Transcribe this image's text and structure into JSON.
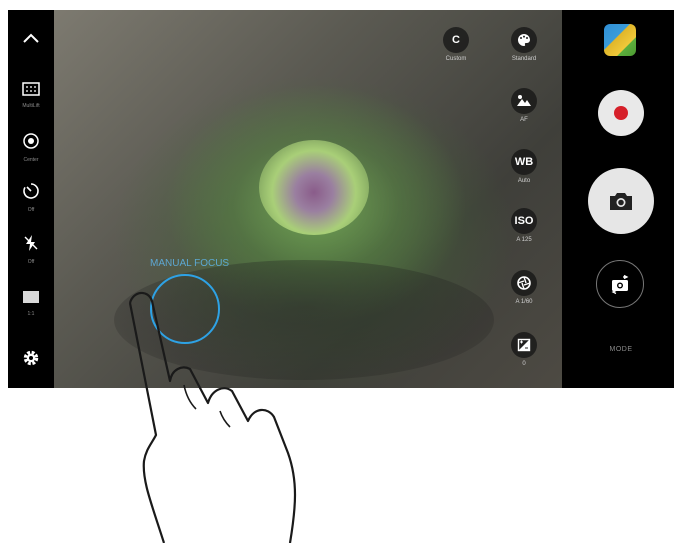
{
  "left_bar": {
    "collapse_icon": "chevron-up-icon",
    "items": [
      {
        "name": "picture-size",
        "icon": "grid-ratio-icon",
        "label": "MultiLift"
      },
      {
        "name": "metering",
        "icon": "metering-icon",
        "label": "Center"
      },
      {
        "name": "timer",
        "icon": "timer-icon",
        "label": "Off"
      },
      {
        "name": "flash",
        "icon": "flash-off-icon",
        "label": "Off"
      },
      {
        "name": "ratio",
        "icon": "aspect-ratio-icon",
        "label": "1:1"
      },
      {
        "name": "settings",
        "icon": "gear-icon",
        "label": ""
      }
    ]
  },
  "viewfinder": {
    "focus_label": "MANUAL FOCUS"
  },
  "controls": [
    {
      "name": "custom",
      "symbol": "C",
      "label": "Custom"
    },
    {
      "name": "tone",
      "symbol": "",
      "label": "Standard"
    },
    {
      "name": "focus",
      "symbol": "",
      "label": "AF"
    },
    {
      "name": "white-balance",
      "symbol": "WB",
      "label": "Auto"
    },
    {
      "name": "iso",
      "symbol": "ISO",
      "label": "A 125"
    },
    {
      "name": "shutter-speed",
      "symbol": "",
      "label": "A 1/60"
    },
    {
      "name": "exposure",
      "symbol": "",
      "label": "0"
    }
  ],
  "right_bar": {
    "mode_label": "MODE"
  },
  "colors": {
    "accent": "#2ea2e5",
    "record": "#d6202a",
    "shutter": "#e6e6e6"
  }
}
